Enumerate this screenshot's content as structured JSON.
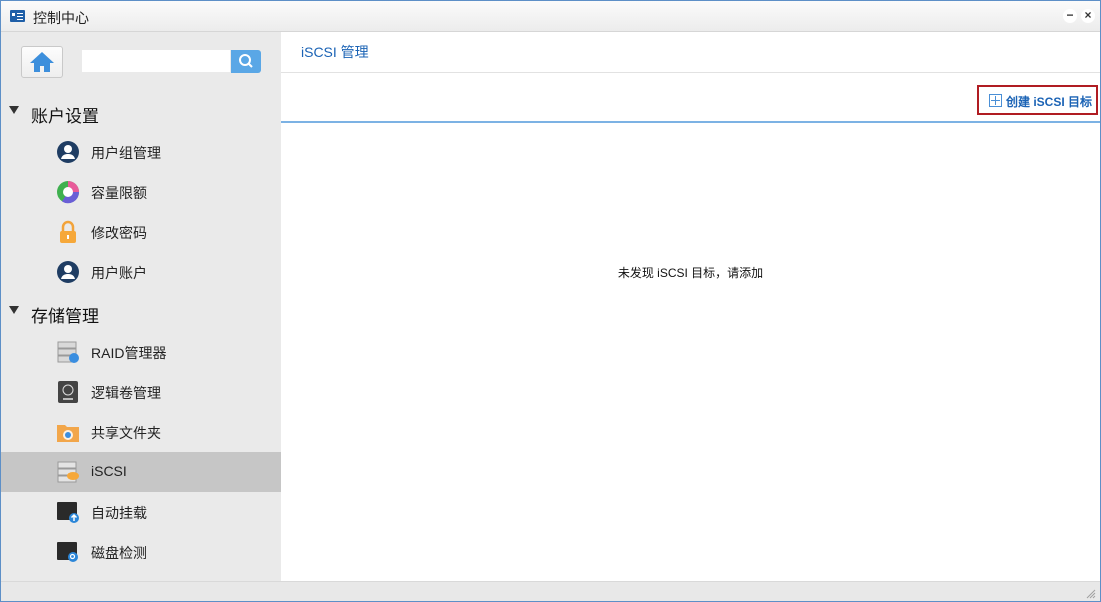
{
  "window": {
    "title": "控制中心",
    "minimize_glyph": "−",
    "close_glyph": "×"
  },
  "sidebar": {
    "search": {
      "value": "",
      "placeholder": ""
    },
    "sections": [
      {
        "label": "账户设置",
        "items": [
          {
            "label": "用户组管理",
            "icon": "user-group-icon"
          },
          {
            "label": "容量限额",
            "icon": "quota-pie-icon"
          },
          {
            "label": "修改密码",
            "icon": "lock-icon"
          },
          {
            "label": "用户账户",
            "icon": "user-account-icon"
          }
        ]
      },
      {
        "label": "存储管理",
        "items": [
          {
            "label": "RAID管理器",
            "icon": "raid-icon"
          },
          {
            "label": "逻辑卷管理",
            "icon": "lvm-icon"
          },
          {
            "label": "共享文件夹",
            "icon": "shared-folder-icon"
          },
          {
            "label": "iSCSI",
            "icon": "iscsi-icon",
            "selected": true
          },
          {
            "label": "自动挂载",
            "icon": "auto-mount-icon"
          },
          {
            "label": "磁盘检测",
            "icon": "disk-check-icon"
          }
        ]
      }
    ]
  },
  "main": {
    "tab_title": "iSCSI 管理",
    "create_button": "创建 iSCSI 目标",
    "empty_message": "未发现 iSCSI 目标，请添加"
  },
  "colors": {
    "accent": "#1b63b5",
    "highlight_border": "#b01c22",
    "selected_row": "#c6c6c6",
    "sidebar_bg": "#eaeaea"
  }
}
